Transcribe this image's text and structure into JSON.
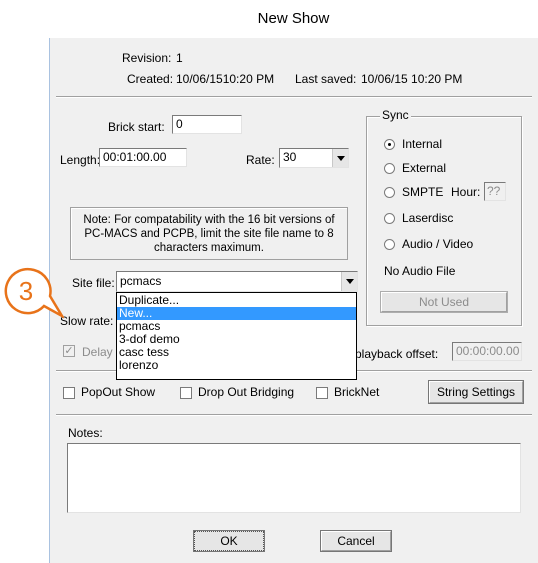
{
  "window": {
    "title": "New Show"
  },
  "info": {
    "revision_label": "Revision:",
    "revision_value": "1",
    "created_label": "Created:",
    "created_value": "10/06/1510:20 PM",
    "last_saved_label": "Last saved:",
    "last_saved_value": "10/06/15 10:20 PM"
  },
  "fields": {
    "brick_start_label": "Brick start:",
    "brick_start_value": "0",
    "length_label": "Length:",
    "length_value": "00:01:00.00",
    "rate_label": "Rate:",
    "rate_value": "30"
  },
  "note": "Note: For compatability with the 16 bit versions of PC-MACS and PCPB, limit the site file name to 8 characters maximum.",
  "site_file": {
    "label": "Site file:",
    "value": "pcmacs",
    "options": [
      {
        "label": "Duplicate...",
        "highlighted": false
      },
      {
        "label": "New...",
        "highlighted": true
      },
      {
        "label": "pcmacs",
        "highlighted": false
      },
      {
        "label": "3-dof demo",
        "highlighted": false
      },
      {
        "label": "casc tess",
        "highlighted": false
      },
      {
        "label": "lorenzo",
        "highlighted": false
      }
    ]
  },
  "slow_rate_label": "Slow rate:",
  "delay_label": "Delay",
  "playback_offset": {
    "label": "playback offset:",
    "value": "00:00:00.00"
  },
  "sync": {
    "legend": "Sync",
    "options": {
      "internal": "Internal",
      "external": "External",
      "smpte": "SMPTE",
      "laserdisc": "Laserdisc",
      "audio_video": "Audio / Video"
    },
    "selected": "Internal",
    "hour_label": "Hour:",
    "hour_value": "??",
    "no_audio_file": "No Audio File",
    "not_used_button": "Not Used"
  },
  "options_row": {
    "popout_show": "PopOut Show",
    "drop_out_bridging": "Drop Out Bridging",
    "bricknet": "BrickNet",
    "string_settings": "String Settings"
  },
  "notes_label": "Notes:",
  "buttons": {
    "ok": "OK",
    "cancel": "Cancel"
  },
  "callout": {
    "number": "3",
    "color": "#e8731a"
  }
}
